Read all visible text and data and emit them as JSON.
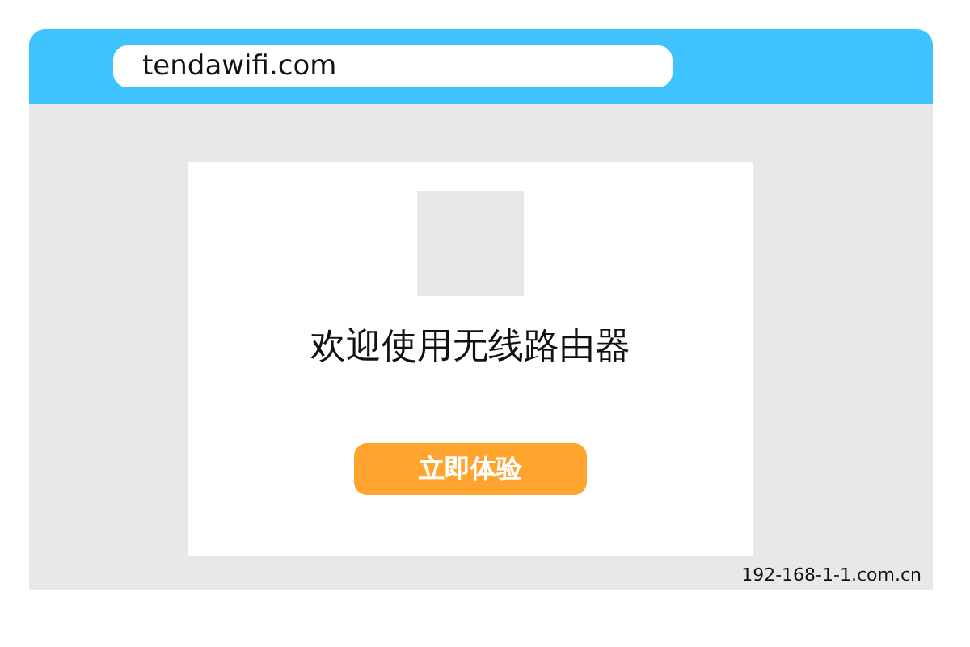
{
  "address_bar": {
    "url": "tendawifi.com"
  },
  "welcome_card": {
    "title": "欢迎使用无线路由器",
    "button": "立即体验"
  },
  "footer": {
    "text": "192-168-1-1.com.cn"
  }
}
